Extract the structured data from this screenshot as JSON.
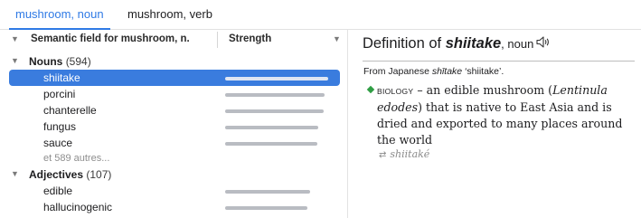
{
  "tabs": [
    {
      "label": "mushroom, noun",
      "active": true
    },
    {
      "label": "mushroom, verb",
      "active": false
    }
  ],
  "columns": {
    "field_prefix": "Semantic field for ",
    "field_word": "mushroom",
    "field_suffix": ", n.",
    "strength": "Strength"
  },
  "groups": {
    "nouns": {
      "label": "Nouns",
      "count": "(594)",
      "items": [
        {
          "word": "shiitake",
          "strength": 0.95,
          "selected": true
        },
        {
          "word": "porcini",
          "strength": 0.92
        },
        {
          "word": "chanterelle",
          "strength": 0.91
        },
        {
          "word": "fungus",
          "strength": 0.86
        },
        {
          "word": "sauce",
          "strength": 0.85
        }
      ],
      "more": "et 589 autres..."
    },
    "adjectives": {
      "label": "Adjectives",
      "count": "(107)",
      "items": [
        {
          "word": "edible",
          "strength": 0.78
        },
        {
          "word": "hallucinogenic",
          "strength": 0.76
        }
      ]
    }
  },
  "definition": {
    "title_prefix": "Definition of ",
    "headword": "shiitake",
    "pos": ", noun",
    "ety_prefix": "From Japanese ",
    "ety_word": "shītake",
    "ety_suffix": " ‘shiitake’.",
    "field": "BIOLOGY",
    "text_a": " – an edible mushroom (",
    "latin": "Lentinula edodes",
    "text_b": ") that is native to East Asia and is dried and exported to many places around the world",
    "xref": "shiitaké"
  },
  "colors": {
    "accent": "#2f7ae5",
    "selection": "#3a7cde",
    "diamond": "#2f9e44"
  },
  "icons": [
    "chevron-down-icon",
    "speaker-icon",
    "swap-arrows-icon",
    "diamond-bullet-icon"
  ]
}
